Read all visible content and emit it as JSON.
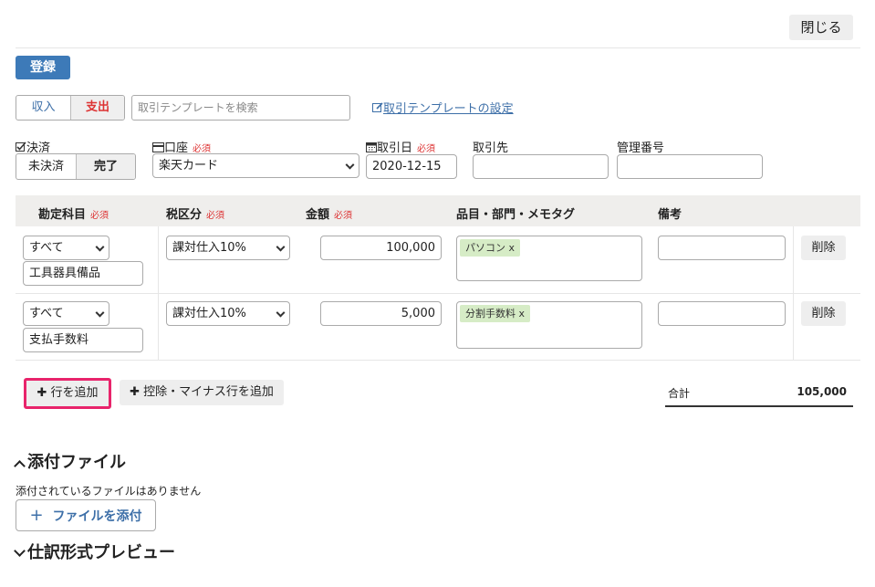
{
  "header": {
    "close_label": "閉じる",
    "register_label": "登録"
  },
  "type_toggle": {
    "income": "収入",
    "expense": "支出",
    "selected": "支出"
  },
  "template": {
    "search_placeholder": "取引テンプレートを検索",
    "settings_link": "取引テンプレートの設定"
  },
  "required_mark": "必須",
  "fields": {
    "settlement": {
      "label": "決済",
      "unsettled": "未決済",
      "completed": "完了",
      "selected": "完了"
    },
    "account": {
      "label": "口座",
      "value": "楽天カード"
    },
    "date": {
      "label": "取引日",
      "value": "2020-12-15"
    },
    "partner": {
      "label": "取引先",
      "value": ""
    },
    "manage_no": {
      "label": "管理番号",
      "value": ""
    }
  },
  "table": {
    "headers": [
      "勘定科目",
      "税区分",
      "金額",
      "品目・部門・メモタグ",
      "備考"
    ],
    "rows": [
      {
        "category_filter": "すべて",
        "account_item": "工具器具備品",
        "tax": "課対仕入10%",
        "amount": "100,000",
        "tag": "パソコン",
        "tag_remove": "x",
        "memo": "",
        "delete_label": "削除"
      },
      {
        "category_filter": "すべて",
        "account_item": "支払手数料",
        "tax": "課対仕入10%",
        "amount": "5,000",
        "tag": "分割手数料",
        "tag_remove": "x",
        "memo": "",
        "delete_label": "削除"
      }
    ]
  },
  "actions": {
    "add_row": "行を追加",
    "add_deduction": "控除・マイナス行を追加"
  },
  "total": {
    "label": "合計",
    "value": "105,000"
  },
  "attachments": {
    "title": "添付ファイル",
    "empty_text": "添付されているファイルはありません",
    "attach_button": "ファイルを添付"
  },
  "journal_preview": {
    "title": "仕訳形式プレビュー"
  },
  "icons": {
    "checkbox": "check-square-icon",
    "card": "credit-card-icon",
    "calendar": "calendar-icon",
    "edit": "edit-icon",
    "plus": "plus-icon",
    "chevron": "chevron-icon"
  },
  "colors": {
    "primary": "#3d7ab8",
    "required": "#dd3333",
    "link": "#3d6fa8",
    "tag_bg": "#d6ecc6",
    "highlight": "#e8246b"
  }
}
